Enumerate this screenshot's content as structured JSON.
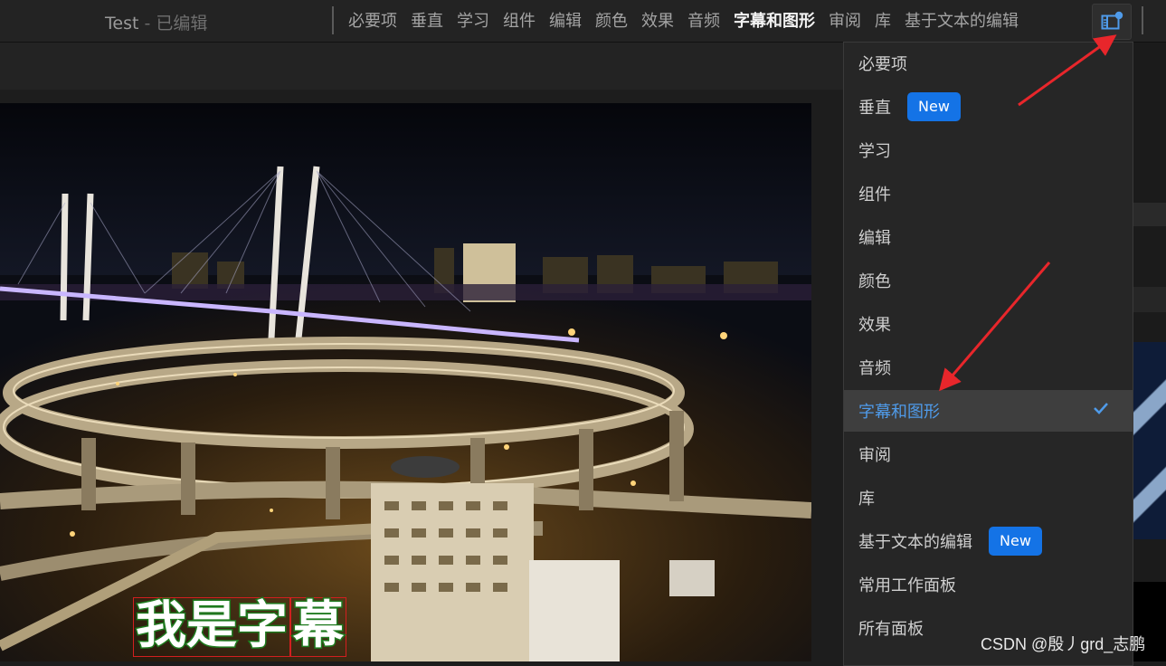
{
  "header": {
    "project_name": "Test",
    "separator": " - ",
    "project_status": "已编辑",
    "tabs": [
      "必要项",
      "垂直",
      "学习",
      "组件",
      "编辑",
      "颜色",
      "效果",
      "音频",
      "字幕和图形",
      "审阅",
      "库",
      "基于文本的编辑"
    ],
    "active_tab": "字幕和图形",
    "workspaces_icon": "workspaces-icon"
  },
  "workspace_menu": {
    "items": [
      {
        "label": "必要项"
      },
      {
        "label": "垂直",
        "badge": "New"
      },
      {
        "label": "学习"
      },
      {
        "label": "组件"
      },
      {
        "label": "编辑"
      },
      {
        "label": "颜色"
      },
      {
        "label": "效果"
      },
      {
        "label": "音频"
      },
      {
        "label": "字幕和图形",
        "selected": true
      },
      {
        "label": "审阅"
      },
      {
        "label": "库"
      },
      {
        "label": "基于文本的编辑",
        "badge": "New"
      },
      {
        "label": "常用工作面板"
      },
      {
        "label": "所有面板"
      }
    ],
    "selected_color": "#4f9bea",
    "badge_color": "#1473e6"
  },
  "viewer": {
    "subtitle_text": [
      "我是字",
      "幕"
    ]
  },
  "watermark": "CSDN @殷丿grd_志鹏",
  "annotations": {
    "arrow_color": "#e8262b"
  }
}
